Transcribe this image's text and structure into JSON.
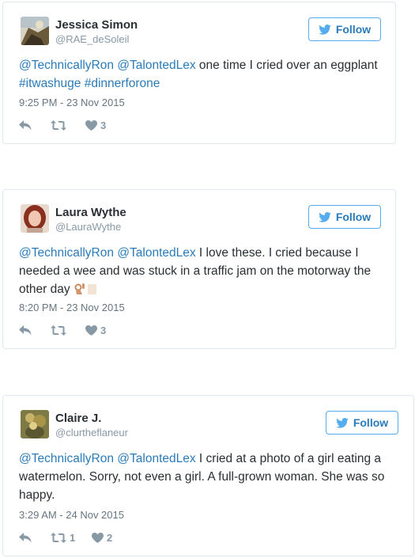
{
  "follow_label": "Follow",
  "colors": {
    "link": "#2b7bb9",
    "follow_border": "#55acee",
    "meta": "#66757f",
    "icon": "#8899a6",
    "border": "#e1e8ed"
  },
  "tweets": [
    {
      "name": "Jessica Simon",
      "handle": "@RAE_deSoleil",
      "mention1": "@TechnicallyRon",
      "mention2": "@TalontedLex",
      "text": " one time I cried over an eggplant ",
      "hashtag1": "#itwashuge",
      "hashtag2": "#dinnerforone",
      "timestamp": "9:25 PM - 23 Nov 2015",
      "retweets": "",
      "likes": "3"
    },
    {
      "name": "Laura Wythe",
      "handle": "@LauraWythe",
      "mention1": "@TechnicallyRon",
      "mention2": "@TalontedLex",
      "text": " I love these. I cried because I needed a wee and was stuck in a traffic jam on the motorway the other day ",
      "emoji": "ok-hand-emoji",
      "timestamp": "8:20 PM - 23 Nov 2015",
      "retweets": "",
      "likes": "3"
    },
    {
      "name": "Claire J.",
      "handle": "@clurtheflaneur",
      "mention1": "@TechnicallyRon",
      "mention2": "@TalontedLex",
      "text": " I cried at a photo of a girl eating a watermelon. Sorry, not even a girl. A full-grown woman. She was so happy.",
      "timestamp": "3:29 AM - 24 Nov 2015",
      "retweets": "1",
      "likes": "2"
    }
  ]
}
